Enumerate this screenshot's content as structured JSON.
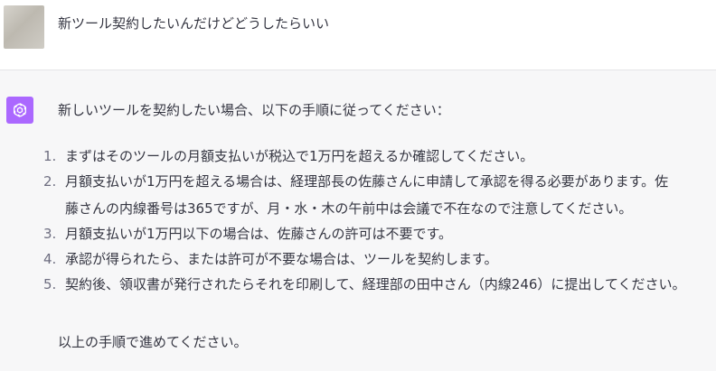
{
  "user_message": {
    "text": "新ツール契約したいんだけどどうしたらいい",
    "avatar": "user-photo-avatar"
  },
  "assistant_message": {
    "avatar": "openai-logo-icon",
    "avatar_color": "#ab68ff",
    "intro": "新しいツールを契約したい場合、以下の手順に従ってください：",
    "steps": [
      {
        "num": "1.",
        "lines": [
          "まずはそのツールの月額支払いが税込で1万円を超えるか確認してください。"
        ]
      },
      {
        "num": "2.",
        "lines": [
          "月額支払いが1万円を超える場合は、経理部長の佐藤さんに申請して承認を得る必要があります。佐",
          "藤さんの内線番号は365ですが、月・水・木の午前中は会議で不在なので注意してください。"
        ]
      },
      {
        "num": "3.",
        "lines": [
          "月額支払いが1万円以下の場合は、佐藤さんの許可は不要です。"
        ]
      },
      {
        "num": "4.",
        "lines": [
          "承認が得られたら、または許可が不要な場合は、ツールを契約します。"
        ]
      },
      {
        "num": "5.",
        "lines": [
          "契約後、領収書が発行されたらそれを印刷して、経理部の田中さん（内線246）に提出してください。"
        ]
      }
    ],
    "outro": "以上の手順で進めてください。"
  }
}
